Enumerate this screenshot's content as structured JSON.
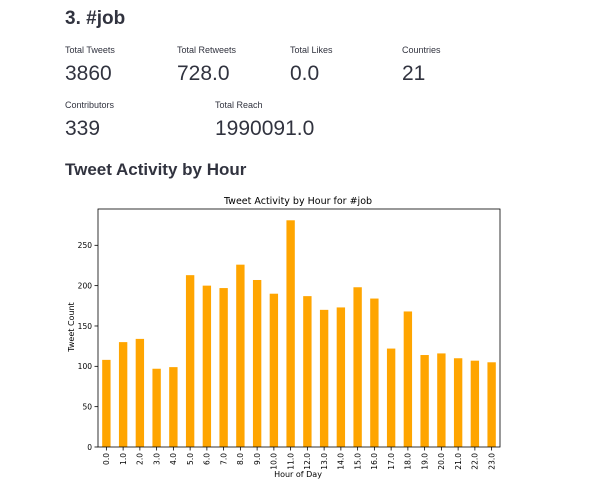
{
  "section": {
    "title": "3. #job"
  },
  "metrics": {
    "total_tweets": {
      "label": "Total Tweets",
      "value": "3860"
    },
    "total_retweets": {
      "label": "Total Retweets",
      "value": "728.0"
    },
    "total_likes": {
      "label": "Total Likes",
      "value": "0.0"
    },
    "countries": {
      "label": "Countries",
      "value": "21"
    },
    "contributors": {
      "label": "Contributors",
      "value": "339"
    },
    "total_reach": {
      "label": "Total Reach",
      "value": "1990091.0"
    }
  },
  "chart_heading": "Tweet Activity by Hour",
  "chart_data": {
    "type": "bar",
    "title": "Tweet Activity by Hour for #job",
    "xlabel": "Hour of Day",
    "ylabel": "Tweet Count",
    "categories": [
      "0.0",
      "1.0",
      "2.0",
      "3.0",
      "4.0",
      "5.0",
      "6.0",
      "7.0",
      "8.0",
      "9.0",
      "10.0",
      "11.0",
      "12.0",
      "13.0",
      "14.0",
      "15.0",
      "16.0",
      "17.0",
      "18.0",
      "19.0",
      "20.0",
      "21.0",
      "22.0",
      "23.0"
    ],
    "values": [
      108,
      130,
      134,
      97,
      99,
      213,
      200,
      197,
      226,
      207,
      190,
      281,
      187,
      170,
      173,
      198,
      184,
      122,
      168,
      114,
      116,
      110,
      107,
      105
    ],
    "ylim": [
      0,
      295
    ],
    "yticks": [
      0,
      50,
      100,
      150,
      200,
      250
    ],
    "bar_color": "#ffa500",
    "grid": false
  }
}
